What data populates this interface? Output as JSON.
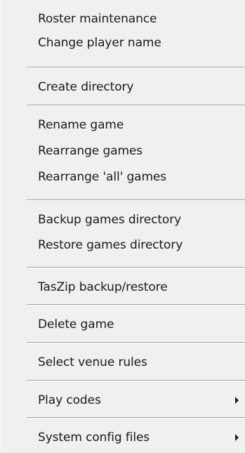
{
  "context_menu": {
    "groups": [
      {
        "items": [
          {
            "label": "Roster maintenance"
          },
          {
            "label": "Change player name"
          }
        ]
      },
      {
        "items": [
          {
            "label": "Create directory"
          }
        ]
      },
      {
        "items": [
          {
            "label": "Rename game"
          },
          {
            "label": "Rearrange games"
          },
          {
            "label": "Rearrange 'all' games"
          }
        ]
      },
      {
        "items": [
          {
            "label": "Backup games directory"
          },
          {
            "label": "Restore games directory"
          }
        ]
      },
      {
        "items": [
          {
            "label": "TasZip backup/restore"
          }
        ]
      },
      {
        "items": [
          {
            "label": "Delete game"
          }
        ]
      },
      {
        "items": [
          {
            "label": "Select venue rules"
          }
        ]
      },
      {
        "items": [
          {
            "label": "Play codes",
            "submenu": true,
            "icon": "submenu-arrow-icon"
          }
        ]
      },
      {
        "items": [
          {
            "label": "System config files",
            "submenu": true,
            "icon": "submenu-arrow-icon"
          }
        ]
      }
    ],
    "colors": {
      "background": "#f0f0f0",
      "text": "#1a1a1a",
      "separator": "#a0a0a0"
    }
  }
}
